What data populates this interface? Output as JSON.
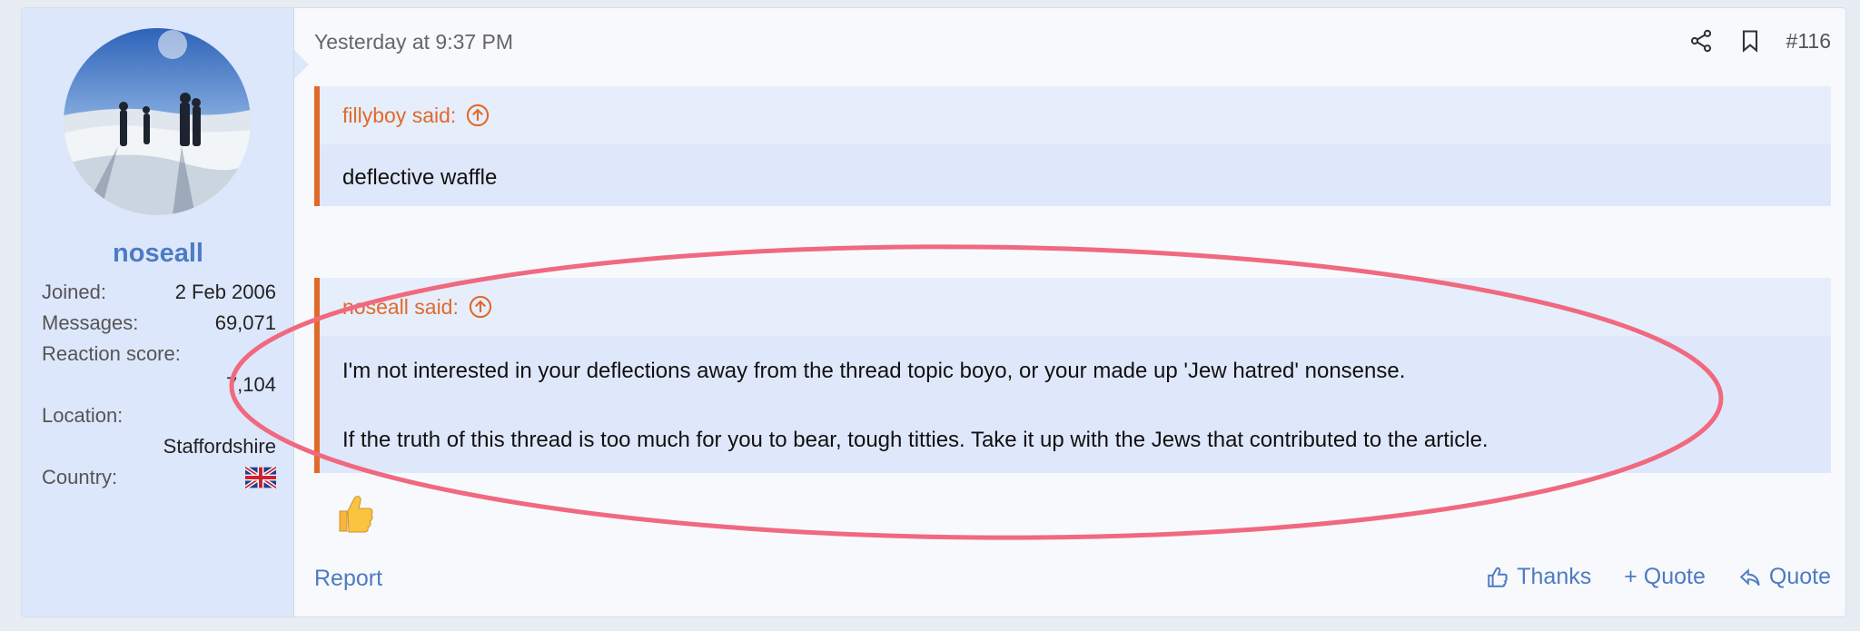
{
  "user": {
    "username": "noseall",
    "stats": [
      {
        "label": "Joined:",
        "value": "2 Feb 2006"
      },
      {
        "label": "Messages:",
        "value": "69,071"
      },
      {
        "label": "Reaction score:",
        "value": "7,104"
      },
      {
        "label": "Location:",
        "value": "Staffordshire"
      },
      {
        "label": "Country:",
        "value": "flag-uk-icon"
      }
    ]
  },
  "post": {
    "date": "Yesterday at 9:37 PM",
    "number": "#116",
    "quotes": [
      {
        "author_label": "fillyboy said:",
        "text": "deflective waffle"
      },
      {
        "author_label": "noseall said:",
        "paragraphs": [
          "I'm not interested in your deflections away from the thread topic boyo, or your made up 'Jew hatred' nonsense.",
          "If the truth of this thread is too much for you to bear, tough titties. Take it up with the Jews that contributed to the article."
        ]
      }
    ],
    "reaction": "thumbs-up-icon"
  },
  "actions": {
    "report": "Report",
    "thanks": "Thanks",
    "multi_quote": "+ Quote",
    "quote": "Quote"
  },
  "colors": {
    "accent": "#4d7bc3",
    "quote_border": "#e06a2a",
    "highlight": "#f0697f"
  }
}
